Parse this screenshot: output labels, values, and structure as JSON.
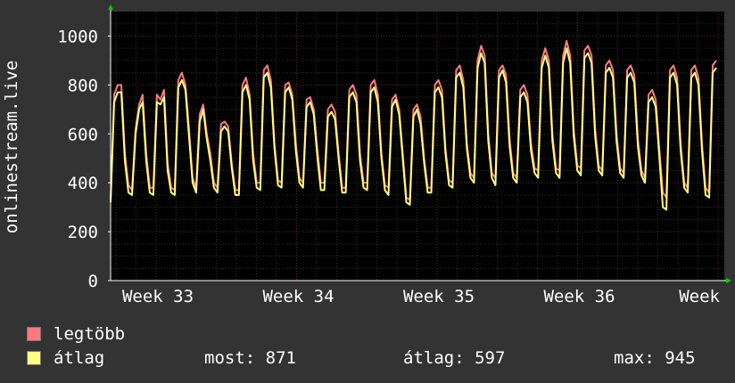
{
  "chart_data": {
    "type": "line",
    "title": "",
    "ylabel": "onlinestream.live",
    "xlabel": "",
    "ylim": [
      0,
      1100
    ],
    "yticks": [
      0,
      200,
      400,
      600,
      800,
      1000
    ],
    "x_labels": [
      "Week 33",
      "Week 34",
      "Week 35",
      "Week 36",
      "Week"
    ],
    "grid": true,
    "legend_placement": "bottom-left",
    "series": [
      {
        "name": "legtöbb",
        "color": "#ff7a80",
        "values": [
          330,
          760,
          800,
          800,
          520,
          390,
          370,
          620,
          720,
          760,
          520,
          380,
          380,
          760,
          740,
          780,
          480,
          380,
          370,
          820,
          850,
          800,
          620,
          420,
          380,
          680,
          720,
          600,
          520,
          400,
          380,
          640,
          650,
          630,
          480,
          370,
          370,
          800,
          830,
          760,
          520,
          400,
          400,
          860,
          880,
          820,
          560,
          410,
          400,
          800,
          810,
          760,
          560,
          420,
          400,
          740,
          750,
          700,
          540,
          400,
          400,
          700,
          720,
          690,
          520,
          380,
          380,
          780,
          800,
          760,
          520,
          400,
          400,
          800,
          820,
          760,
          520,
          390,
          380,
          740,
          760,
          700,
          520,
          340,
          330,
          700,
          720,
          670,
          500,
          380,
          380,
          800,
          820,
          780,
          540,
          410,
          400,
          860,
          880,
          820,
          560,
          440,
          420,
          900,
          960,
          920,
          600,
          440,
          420,
          860,
          880,
          840,
          580,
          440,
          420,
          780,
          800,
          760,
          560,
          460,
          450,
          900,
          950,
          900,
          600,
          460,
          450,
          920,
          980,
          920,
          620,
          470,
          460,
          940,
          960,
          920,
          620,
          470,
          450,
          880,
          900,
          860,
          600,
          460,
          440,
          860,
          880,
          840,
          580,
          450,
          420,
          760,
          780,
          740,
          540,
          360,
          340,
          860,
          880,
          830,
          560,
          400,
          380,
          860,
          880,
          830,
          560,
          380,
          360,
          880,
          900
        ]
      },
      {
        "name": "átlag",
        "color": "#ffff80",
        "values": [
          320,
          730,
          770,
          770,
          490,
          360,
          350,
          600,
          700,
          730,
          490,
          360,
          350,
          730,
          720,
          750,
          450,
          360,
          350,
          790,
          820,
          780,
          590,
          400,
          360,
          650,
          700,
          580,
          490,
          380,
          360,
          610,
          630,
          610,
          460,
          350,
          350,
          770,
          800,
          740,
          490,
          380,
          370,
          830,
          850,
          790,
          540,
          390,
          380,
          770,
          790,
          740,
          530,
          400,
          380,
          710,
          730,
          680,
          510,
          370,
          370,
          670,
          690,
          660,
          500,
          360,
          360,
          750,
          770,
          730,
          490,
          380,
          370,
          770,
          790,
          730,
          500,
          370,
          350,
          710,
          740,
          680,
          500,
          320,
          310,
          670,
          700,
          640,
          480,
          360,
          360,
          770,
          790,
          750,
          520,
          390,
          380,
          830,
          850,
          790,
          540,
          420,
          400,
          870,
          930,
          890,
          570,
          420,
          390,
          830,
          860,
          810,
          550,
          420,
          400,
          750,
          770,
          730,
          530,
          440,
          420,
          870,
          920,
          870,
          570,
          440,
          420,
          890,
          950,
          890,
          590,
          450,
          430,
          910,
          930,
          890,
          590,
          450,
          430,
          850,
          870,
          830,
          570,
          440,
          420,
          830,
          850,
          810,
          550,
          430,
          400,
          730,
          750,
          710,
          510,
          300,
          290,
          830,
          850,
          800,
          530,
          380,
          360,
          830,
          850,
          800,
          530,
          350,
          340,
          850,
          870
        ]
      }
    ]
  },
  "legend": {
    "max_label": "legtöbb",
    "avg_label": "átlag",
    "max_color": "#ff7a80",
    "avg_color": "#ffff80"
  },
  "stats": {
    "now_text": "most: 871",
    "avg_text": "átlag: 597",
    "max_text": "max: 945"
  }
}
